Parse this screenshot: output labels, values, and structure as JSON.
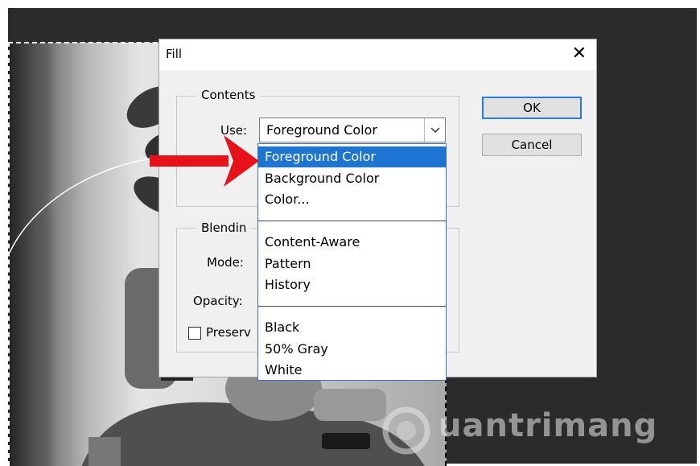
{
  "dialog": {
    "title": "Fill",
    "contents_group_label": "Contents",
    "use_label": "Use:",
    "use_value": "Foreground Color",
    "blending_group_label": "Blendin",
    "mode_label": "Mode:",
    "opacity_label": "Opacity:",
    "preserve_label": "Preserv",
    "ok_label": "OK",
    "cancel_label": "Cancel"
  },
  "dropdown": {
    "options": [
      {
        "label": "Foreground Color",
        "selected": true
      },
      {
        "label": "Background Color",
        "selected": false
      },
      {
        "label": "Color...",
        "selected": false
      },
      {
        "label": "Content-Aware",
        "selected": false
      },
      {
        "label": "Pattern",
        "selected": false
      },
      {
        "label": "History",
        "selected": false
      },
      {
        "label": "Black",
        "selected": false
      },
      {
        "label": "50% Gray",
        "selected": false
      },
      {
        "label": "White",
        "selected": false
      }
    ]
  },
  "watermark": {
    "text": "uantrimang"
  },
  "colors": {
    "accent": "#1e75d1",
    "arrow": "#e8121a",
    "workspace": "#2b2b2b"
  }
}
